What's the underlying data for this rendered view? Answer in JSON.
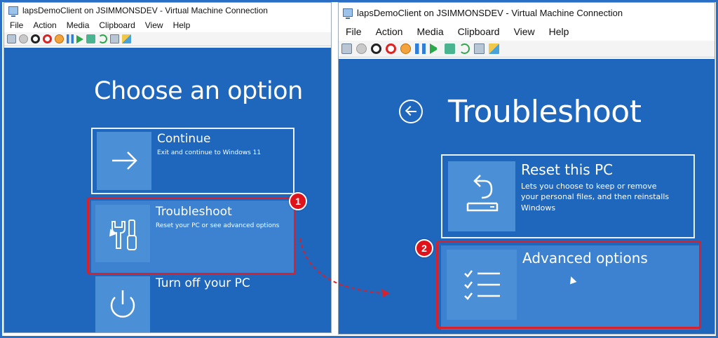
{
  "left_window": {
    "title": "lapsDemoClient on JSIMMONSDEV - Virtual Machine Connection",
    "menu": [
      "File",
      "Action",
      "Media",
      "Clipboard",
      "View",
      "Help"
    ],
    "screen": {
      "heading": "Choose an option",
      "options": [
        {
          "title": "Continue",
          "description": "Exit and continue to Windows 11",
          "icon": "arrow-right-icon"
        },
        {
          "title": "Troubleshoot",
          "description": "Reset your PC or see advanced options",
          "icon": "tools-icon"
        },
        {
          "title": "Turn off your PC",
          "description": "",
          "icon": "power-icon"
        }
      ]
    }
  },
  "right_window": {
    "title": "lapsDemoClient on JSIMMONSDEV - Virtual Machine Connection",
    "menu": [
      "File",
      "Action",
      "Media",
      "Clipboard",
      "View",
      "Help"
    ],
    "screen": {
      "heading": "Troubleshoot",
      "options": [
        {
          "title": "Reset this PC",
          "description": "Lets you choose to keep or remove your personal files, and then reinstalls Windows",
          "icon": "reset-pc-icon"
        },
        {
          "title": "Advanced options",
          "description": "",
          "icon": "checklist-icon"
        }
      ]
    }
  },
  "annotations": {
    "step1": "1",
    "step2": "2",
    "highlight_color": "#d8212a",
    "screen_color": "#1f66bd"
  }
}
